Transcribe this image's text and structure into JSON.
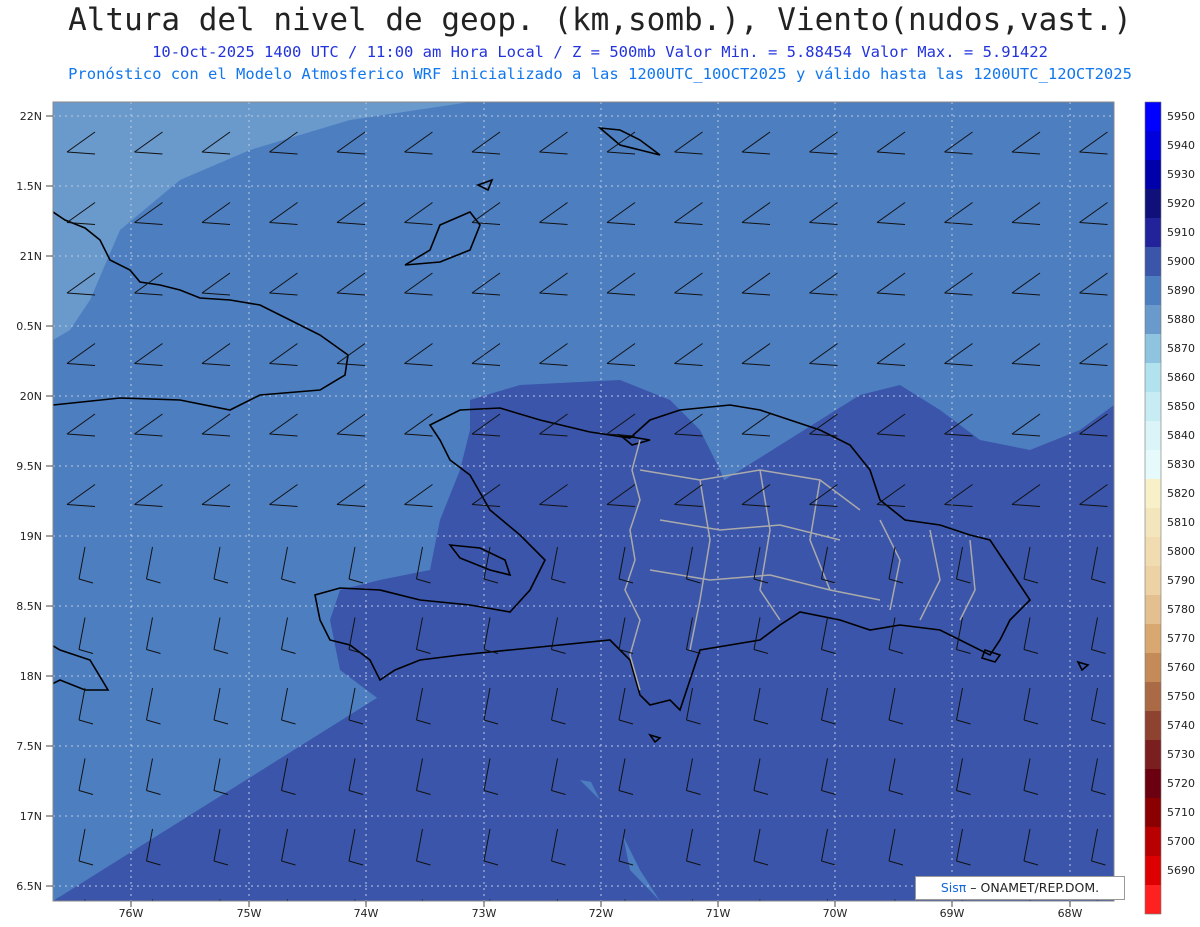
{
  "header": {
    "title": "Altura del nivel de geop. (km,somb.), Viento(nudos,vast.)",
    "subtitle1": "10-Oct-2025  1400 UTC / 11:00 am Hora Local / Z = 500mb   Valor Min. = 5.88454  Valor Max. = 5.91422",
    "subtitle2": "Pronóstico con el Modelo Atmosferico WRF inicializado a las 1200UTC_10OCT2025 y válido hasta las  1200UTC_12OCT2025"
  },
  "axes": {
    "lat_labels": [
      "22N",
      "1.5N",
      "21N",
      "0.5N",
      "20N",
      "9.5N",
      "19N",
      "8.5N",
      "18N",
      "7.5N",
      "17N",
      "6.5N"
    ],
    "lon_labels": [
      "76W",
      "75W",
      "74W",
      "73W",
      "72W",
      "71W",
      "70W",
      "69W",
      "68W"
    ]
  },
  "colorbar": {
    "labels": [
      "5950",
      "5940",
      "5930",
      "5920",
      "5910",
      "5900",
      "5890",
      "5880",
      "5870",
      "5860",
      "5850",
      "5840",
      "5830",
      "5820",
      "5810",
      "5800",
      "5790",
      "5780",
      "5770",
      "5760",
      "5750",
      "5740",
      "5730",
      "5720",
      "5710",
      "5700",
      "5690"
    ],
    "colors": [
      "#0000ff",
      "#0000dd",
      "#0000aa",
      "#10107a",
      "#22229a",
      "#3a55aa",
      "#4d7ec0",
      "#6a9acc",
      "#8ec4e0",
      "#b2e2ee",
      "#c8ecf4",
      "#daf4f8",
      "#e6f9fb",
      "#f8f0c8",
      "#f4e6bc",
      "#f0dcb0",
      "#ecd2a4",
      "#e4c090",
      "#d8a870",
      "#c48a58",
      "#aa6a45",
      "#8e4230",
      "#7a1e20",
      "#6a0010",
      "#8a0000",
      "#b80000",
      "#dd0000",
      "#ff2020"
    ]
  },
  "field": {
    "color_5880": "#6a9acc",
    "color_5890": "#4d7ec0",
    "color_5900": "#3a55aa"
  },
  "credit": {
    "brand": "Sisπ",
    "text": " – ONAMET/REP.DOM."
  }
}
